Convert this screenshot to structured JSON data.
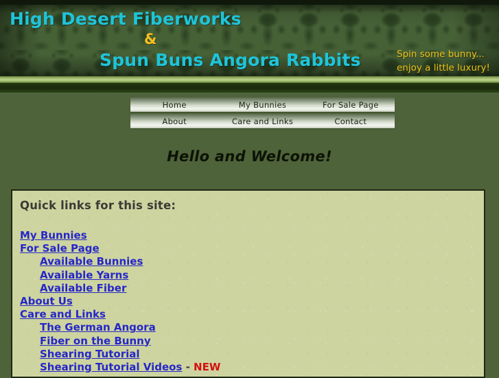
{
  "site": {
    "title_line1": "High Desert Fiberworks",
    "ampersand": "&",
    "title_line2": "Spun Buns Angora Rabbits",
    "tagline_line1": "Spin some bunny...",
    "tagline_line2": "enjoy a little luxury!"
  },
  "nav": {
    "row1": [
      {
        "label": "Home"
      },
      {
        "label": "My Bunnies"
      },
      {
        "label": "For Sale Page"
      }
    ],
    "row2": [
      {
        "label": "About"
      },
      {
        "label": "Care and Links"
      },
      {
        "label": "Contact"
      }
    ]
  },
  "main": {
    "welcome_heading": "Hello and Welcome!",
    "box_title": "Quick links for this site:",
    "links": [
      {
        "label": "My Bunnies",
        "indent": false,
        "badge": ""
      },
      {
        "label": "For Sale Page",
        "indent": false,
        "badge": ""
      },
      {
        "label": "Available Bunnies",
        "indent": true,
        "badge": ""
      },
      {
        "label": "Available Yarns",
        "indent": true,
        "badge": ""
      },
      {
        "label": "Available Fiber",
        "indent": true,
        "badge": ""
      },
      {
        "label": "About Us",
        "indent": false,
        "badge": ""
      },
      {
        "label": "Care and Links",
        "indent": false,
        "badge": ""
      },
      {
        "label": "The German Angora",
        "indent": true,
        "badge": ""
      },
      {
        "label": "Fiber on the Bunny",
        "indent": true,
        "badge": ""
      },
      {
        "label": "Shearing Tutorial",
        "indent": true,
        "badge": ""
      },
      {
        "label": "Shearing Tutorial Videos",
        "indent": true,
        "badge": "NEW",
        "separator": "-"
      }
    ]
  },
  "colors": {
    "page_background": "#4e6339",
    "banner_green": "#476137",
    "title_cyan": "#1fc4d8",
    "accent_gold": "#e9c219",
    "content_background": "#cdd49f",
    "link_blue": "#2727c8",
    "new_red": "#d41010",
    "border_dark": "#1d2714"
  }
}
